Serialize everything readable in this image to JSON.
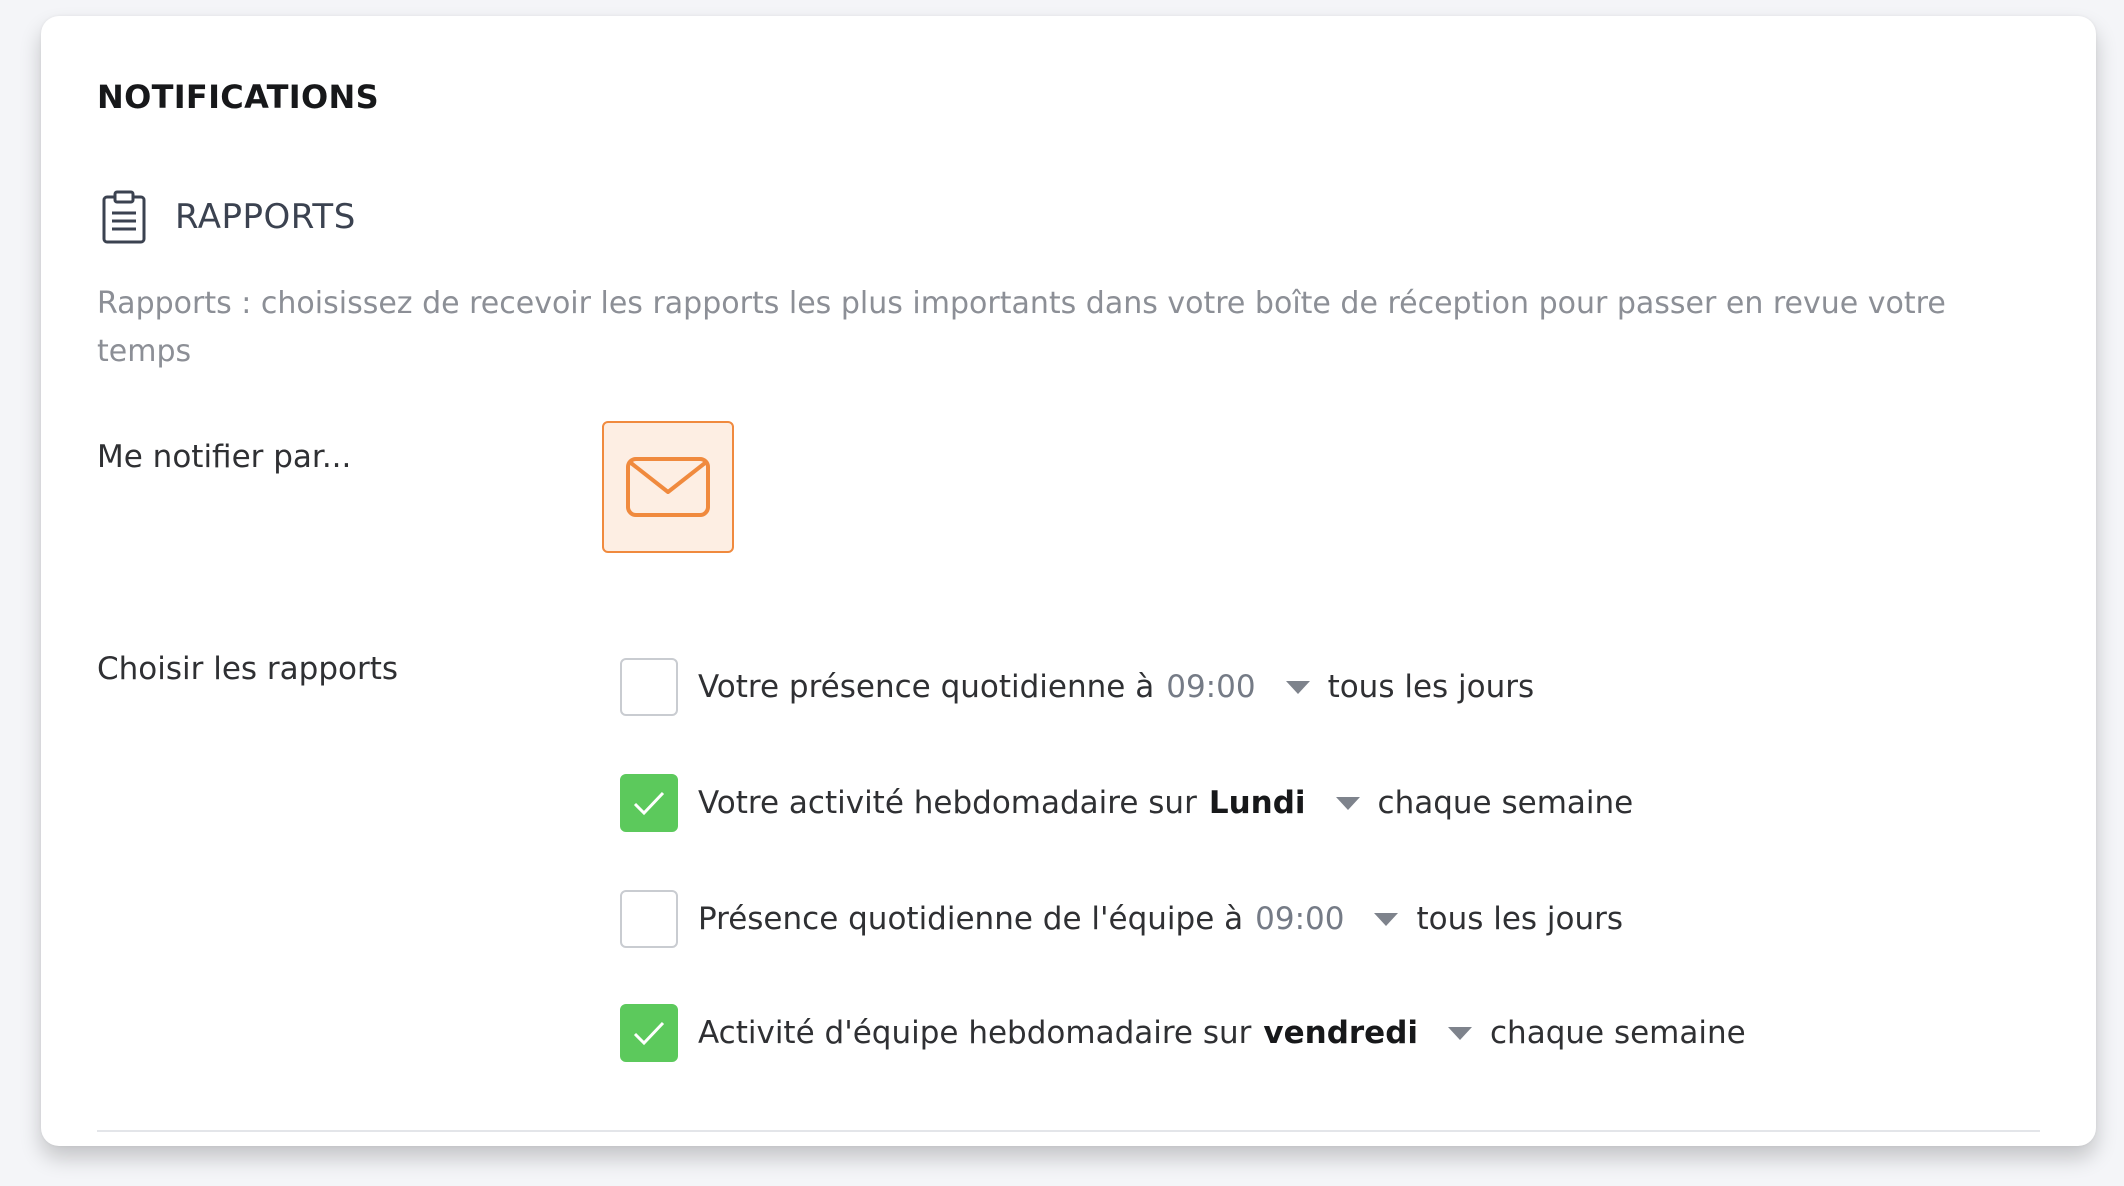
{
  "page": {
    "title": "NOTIFICATIONS"
  },
  "section": {
    "icon": "clipboard-icon",
    "title": "RAPPORTS",
    "description": "Rapports : choisissez de recevoir les rapports les plus importants dans votre boîte de réception pour passer en revue votre temps"
  },
  "notify": {
    "label": "Me notifier par...",
    "channel_icon": "envelope-icon",
    "accent_color": "#f08a3e"
  },
  "reports": {
    "label": "Choisir les rapports",
    "checked_color": "#5cc95c",
    "items": [
      {
        "text": "Votre présence quotidienne à",
        "value": "09:00",
        "frequency": "tous les jours",
        "checked": false
      },
      {
        "text": "Votre activité hebdomadaire sur",
        "value": "Lundi",
        "frequency": "chaque semaine",
        "checked": true
      },
      {
        "text": "Présence quotidienne de l'équipe à",
        "value": "09:00",
        "frequency": "tous les jours",
        "checked": false
      },
      {
        "text": "Activité d'équipe hebdomadaire sur",
        "value": "vendredi",
        "frequency": "chaque semaine",
        "checked": true
      }
    ]
  }
}
